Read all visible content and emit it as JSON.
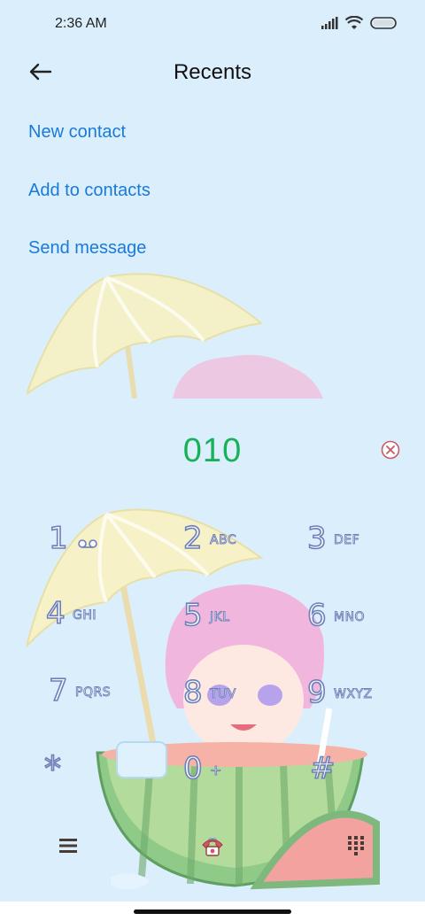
{
  "status": {
    "time": "2:36 AM"
  },
  "header": {
    "title": "Recents"
  },
  "actions": {
    "new_contact": "New contact",
    "add_to_contacts": "Add to contacts",
    "send_message": "Send message"
  },
  "dialer": {
    "number": "010",
    "keys": [
      {
        "digit": "1",
        "letters": ""
      },
      {
        "digit": "2",
        "letters": "ABC"
      },
      {
        "digit": "3",
        "letters": "DEF"
      },
      {
        "digit": "4",
        "letters": "GHI"
      },
      {
        "digit": "5",
        "letters": "JKL"
      },
      {
        "digit": "6",
        "letters": "MNO"
      },
      {
        "digit": "7",
        "letters": "PQRS"
      },
      {
        "digit": "8",
        "letters": "TUV"
      },
      {
        "digit": "9",
        "letters": "WXYZ"
      },
      {
        "digit": "*",
        "letters": ""
      },
      {
        "digit": "0",
        "letters": "+"
      },
      {
        "digit": "#",
        "letters": ""
      }
    ]
  },
  "icons": {
    "voicemail": "voicemail-icon",
    "menu": "menu-icon",
    "call": "call-icon",
    "keypad": "keypad-icon"
  },
  "colors": {
    "background": "#dbeefb",
    "accent_link": "#1a7ad9",
    "number": "#17b157"
  }
}
